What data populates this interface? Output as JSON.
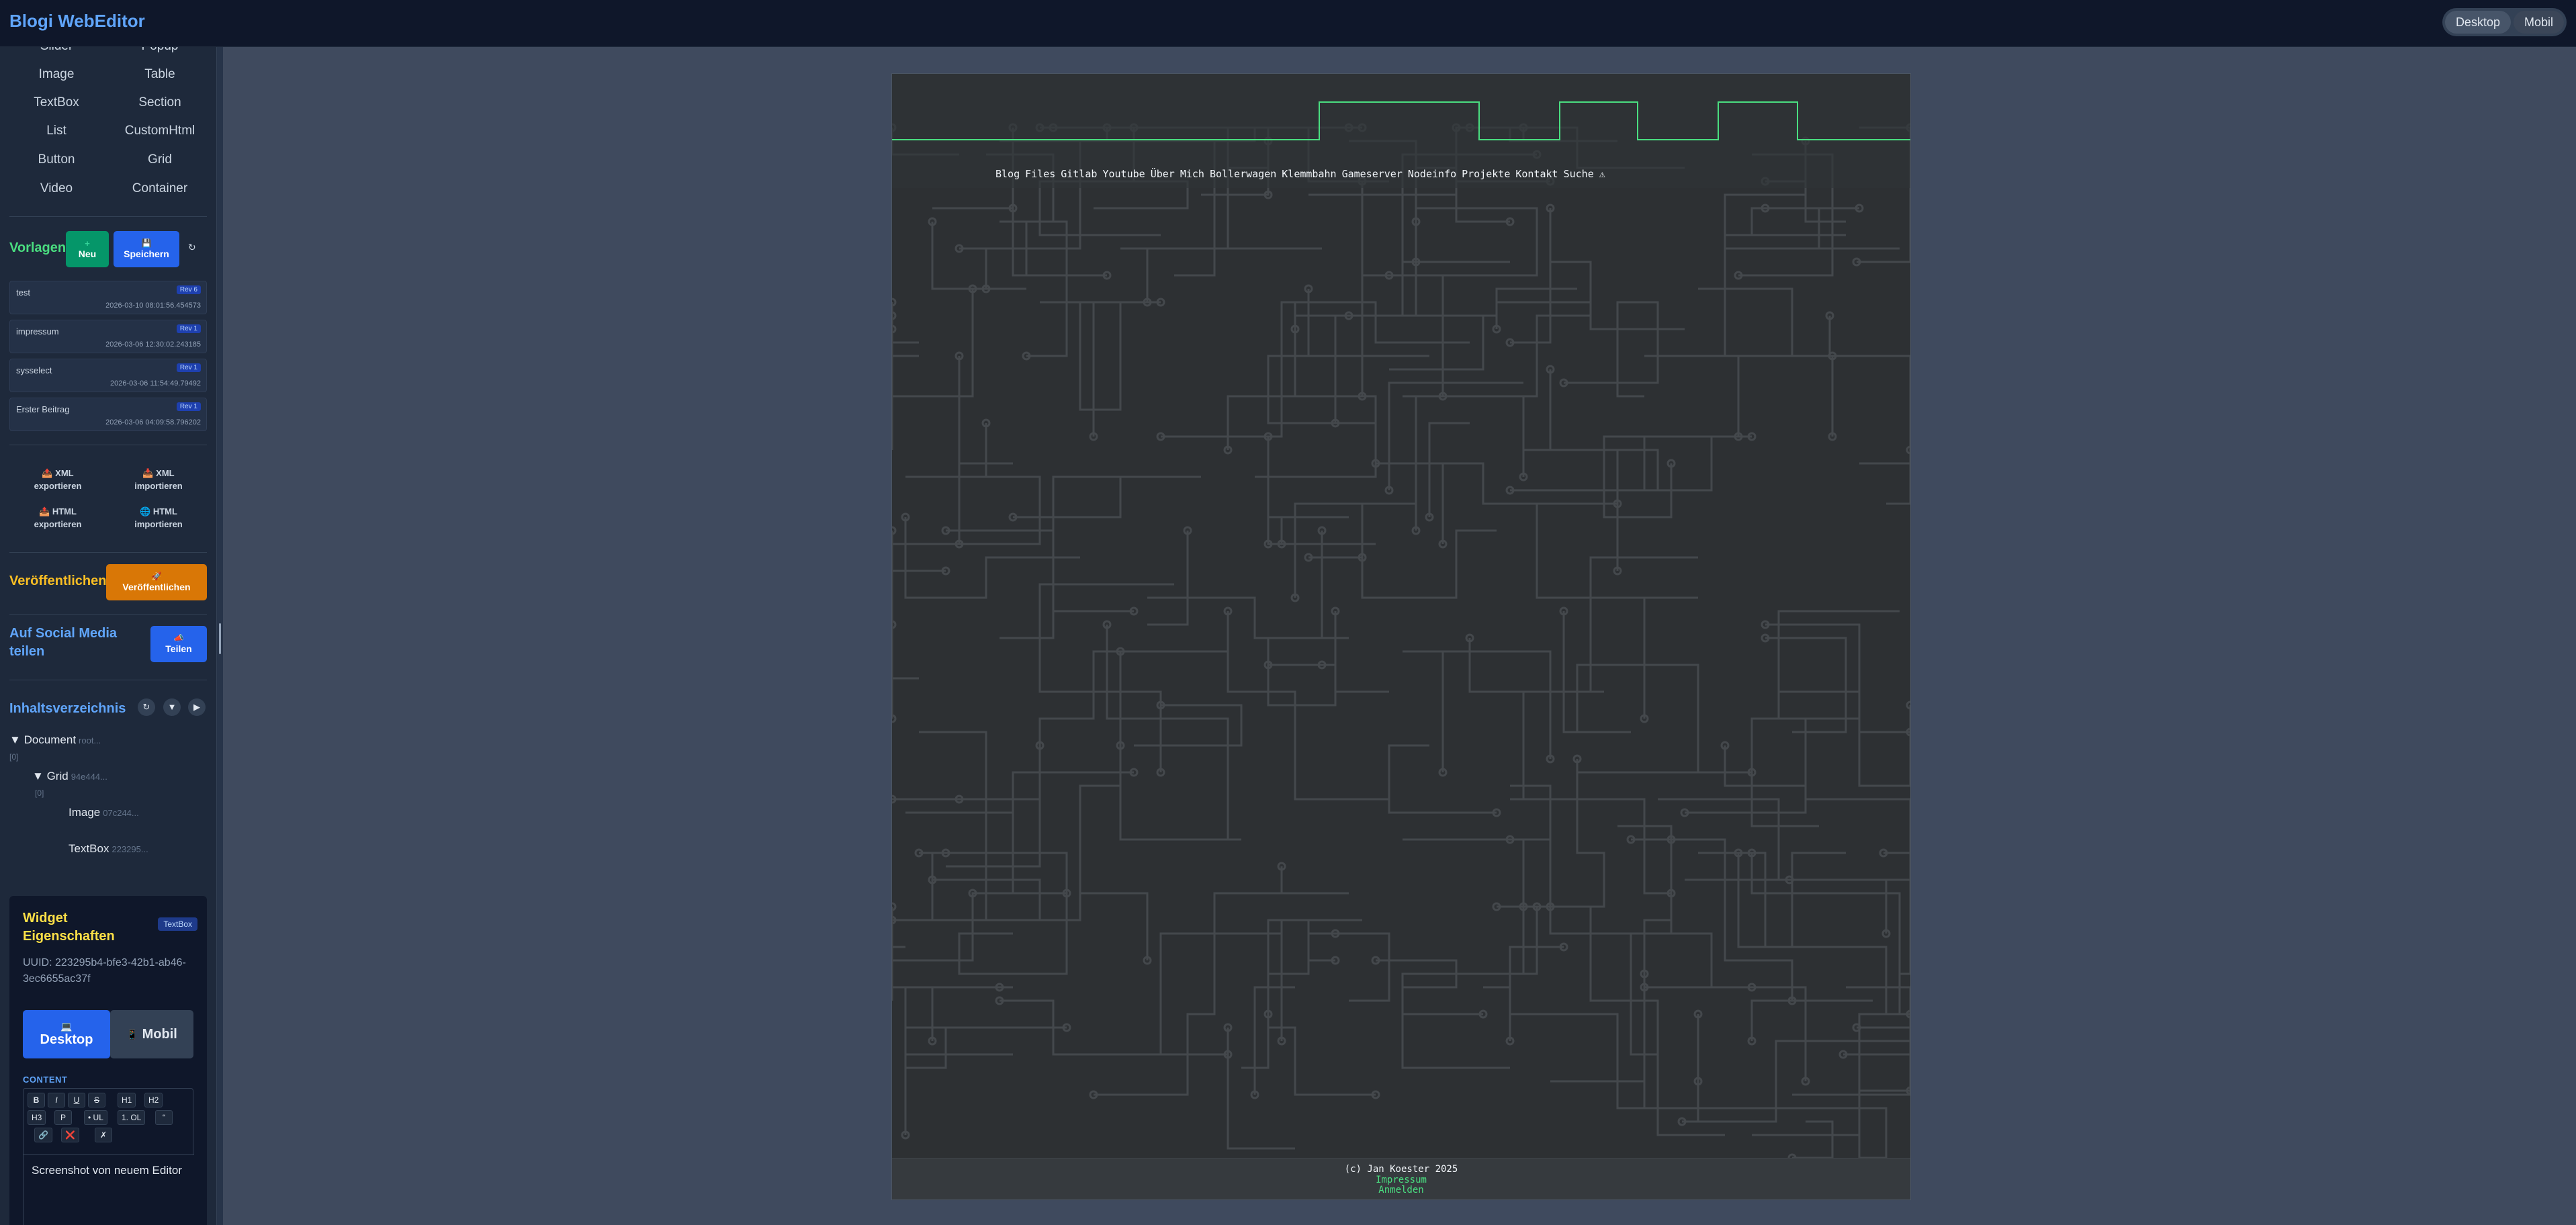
{
  "app": {
    "title": "Blogi WebEditor"
  },
  "view_toggle": {
    "desktop": "Desktop",
    "mobile": "Mobil"
  },
  "widgets": {
    "col1": [
      "Slider",
      "Image",
      "TextBox",
      "List",
      "Button",
      "Video"
    ],
    "col2": [
      "Popup",
      "Table",
      "Section",
      "CustomHtml",
      "Grid",
      "Container"
    ]
  },
  "templates": {
    "title": "Vorlagen",
    "new_icon": "plus-icon",
    "new_label": "Neu",
    "save_icon": "💾",
    "save_label": "Speichern",
    "refresh_icon": "↻",
    "items": [
      {
        "name": "test",
        "rev": "Rev 6",
        "date": "2026-03-10 08:01:56.454573"
      },
      {
        "name": "impressum",
        "rev": "Rev 1",
        "date": "2026-03-06 12:30:02.243185"
      },
      {
        "name": "sysselect",
        "rev": "Rev 1",
        "date": "2026-03-06 11:54:49.79492"
      },
      {
        "name": "Erster Beitrag",
        "rev": "Rev 1",
        "date": "2026-03-06 04:09:58.796202"
      }
    ]
  },
  "io": {
    "xml_export_icon": "📤",
    "xml_export_l1": "XML",
    "xml_export_l2": "exportieren",
    "xml_import_icon": "📥",
    "xml_import_l1": "XML",
    "xml_import_l2": "importieren",
    "html_export_icon": "📤",
    "html_export_l1": "HTML",
    "html_export_l2": "exportieren",
    "html_import_icon": "🌐",
    "html_import_l1": "HTML",
    "html_import_l2": "importieren"
  },
  "publish": {
    "title": "Veröffentlichen",
    "icon": "🚀",
    "button": "Veröffentlichen"
  },
  "share": {
    "title_l1": "Auf Social Media",
    "title_l2": "teilen",
    "icon": "📣",
    "button": "Teilen"
  },
  "toc": {
    "title": "Inhaltsverzeichnis",
    "refresh": "↻",
    "collapse": "▼",
    "expand": "▶",
    "document_label": "Document",
    "document_meta": "root...",
    "document_index": "[0]",
    "grid_label": "Grid",
    "grid_meta": "94e444...",
    "grid_index": "[0]",
    "image_label": "Image",
    "image_meta": "07c244...",
    "textbox_label": "TextBox",
    "textbox_meta": "223295..."
  },
  "properties": {
    "title_l1": "Widget",
    "title_l2": "Eigenschaften",
    "badge": "TextBox",
    "uuid": "UUID: 223295b4-bfe3-42b1-ab46-3ec6655ac37f",
    "tab_desktop_icon": "💻",
    "tab_desktop": "Desktop",
    "tab_mobile_icon": "📱",
    "tab_mobile": "Mobil",
    "content_label": "CONTENT",
    "toolbar": [
      "B",
      "I",
      "U",
      "S",
      "H1",
      "H2",
      "H3",
      "P",
      "• UL",
      "1. OL",
      "“",
      "🔗",
      "❌",
      "✗"
    ],
    "content_text": "Screenshot von neuem Editor"
  },
  "preview": {
    "nav": [
      "Blog",
      "Files",
      "Gitlab",
      "Youtube",
      "Über",
      "Mich",
      "Bollerwagen",
      "Klemmbahn",
      "Gameserver",
      "Nodeinfo",
      "Projekte",
      "Kontakt",
      "Suche",
      "⚠"
    ],
    "footer_copyright": "(c) Jan Koester 2025",
    "footer_link1": "Impressum",
    "footer_link2": "Anmelden",
    "colors": {
      "accent_green": "#4ade80",
      "signal_green": "#4ade80"
    }
  }
}
